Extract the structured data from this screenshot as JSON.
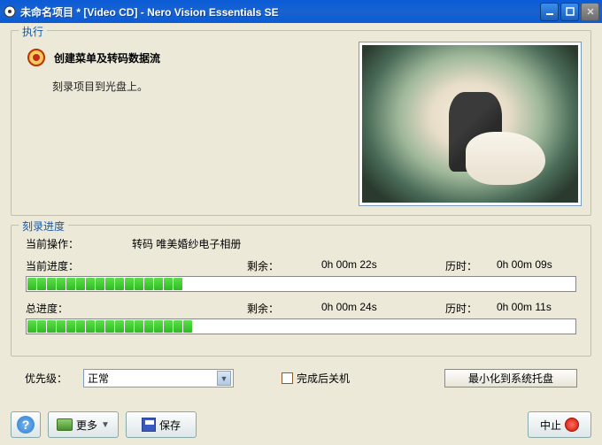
{
  "window": {
    "title": "未命名项目 * [Video CD] - Nero Vision Essentials SE"
  },
  "exec": {
    "legend": "执行",
    "heading": "创建菜单及转码数据流",
    "subtext": "刻录项目到光盘上。"
  },
  "progress": {
    "legend": "刻录进度",
    "current_op_label": "当前操作：",
    "current_op_value": "转码 唯美婚纱电子相册",
    "current_progress_label": "当前进度：",
    "remaining_label": "剩余：",
    "current_remaining": "0h 00m 22s",
    "elapsed_label": "历时：",
    "current_elapsed": "0h 00m 09s",
    "total_label": "总进度：",
    "total_remaining": "0h 00m 24s",
    "total_elapsed": "0h 00m 11s",
    "current_percent": 29,
    "total_percent": 31
  },
  "options": {
    "priority_label": "优先级：",
    "priority_value": "正常",
    "shutdown_label": "完成后关机",
    "tray_button": "最小化到系统托盘"
  },
  "footer": {
    "more": "更多",
    "save": "保存",
    "stop": "中止",
    "help": "?"
  }
}
